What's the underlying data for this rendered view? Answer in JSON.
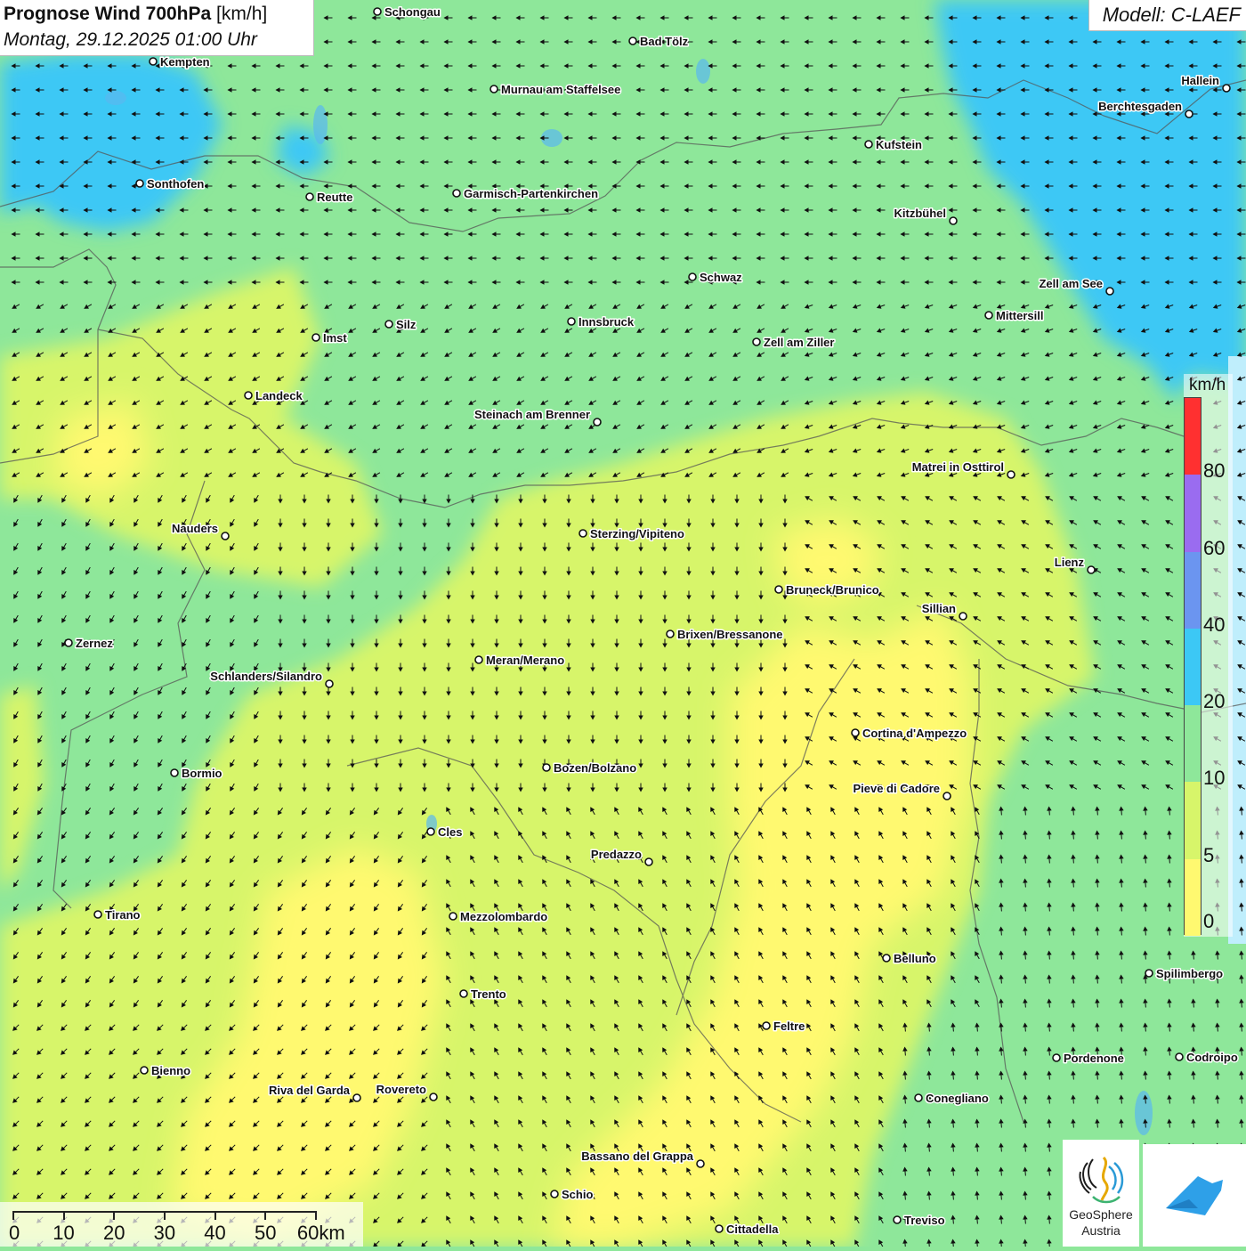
{
  "header": {
    "title_bold": "Prognose Wind 700hPa",
    "title_unit": "[km/h]",
    "date": "Montag, 29.12.2025 01:00 Uhr",
    "model": "Modell: C-LAEF"
  },
  "legend": {
    "unit": "km/h",
    "labels": [
      "80",
      "60",
      "40",
      "20",
      "10",
      "5",
      "0"
    ],
    "colors": [
      "#ff3030",
      "#9a6cf0",
      "#6b95f0",
      "#3cc8f5",
      "#8ee79a",
      "#d7f56a",
      "#fff970"
    ]
  },
  "scale_bar": {
    "labels": [
      "0",
      "10",
      "20",
      "30",
      "40",
      "50",
      "60km"
    ]
  },
  "logo": {
    "name_line1": "GeoSphere",
    "name_line2": "Austria"
  },
  "icons": [
    "geosphere-logo-icon",
    "app-bird-icon"
  ],
  "cities": [
    {
      "name": "Schongau"
    },
    {
      "name": "Bad Tölz"
    },
    {
      "name": "Kempten"
    },
    {
      "name": "Murnau am Staffelsee"
    },
    {
      "name": "Hallein"
    },
    {
      "name": "Berchtesgaden"
    },
    {
      "name": "Kufstein"
    },
    {
      "name": "Sonthofen"
    },
    {
      "name": "Reutte"
    },
    {
      "name": "Garmisch-Partenkirchen"
    },
    {
      "name": "Kitzbühel"
    },
    {
      "name": "Schwaz"
    },
    {
      "name": "Zell am See"
    },
    {
      "name": "Mittersill"
    },
    {
      "name": "Innsbruck"
    },
    {
      "name": "Silz"
    },
    {
      "name": "Imst"
    },
    {
      "name": "Zell am Ziller"
    },
    {
      "name": "Landeck"
    },
    {
      "name": "Steinach am Brenner"
    },
    {
      "name": "Matrei in Osttirol"
    },
    {
      "name": "Nauders"
    },
    {
      "name": "Sterzing/Vipiteno"
    },
    {
      "name": "Lienz"
    },
    {
      "name": "Bruneck/Brunico"
    },
    {
      "name": "Sillian"
    },
    {
      "name": "Brixen/Bressanone"
    },
    {
      "name": "Zernez"
    },
    {
      "name": "Meran/Merano"
    },
    {
      "name": "Schlanders/Silandro"
    },
    {
      "name": "Cortina d'Ampezzo"
    },
    {
      "name": "Bozen/Bolzano"
    },
    {
      "name": "Bormio"
    },
    {
      "name": "Pieve di Cadore"
    },
    {
      "name": "Cles"
    },
    {
      "name": "Predazzo"
    },
    {
      "name": "Tirano"
    },
    {
      "name": "Mezzolombardo"
    },
    {
      "name": "Belluno"
    },
    {
      "name": "Spilimbergo"
    },
    {
      "name": "Trento"
    },
    {
      "name": "Feltre"
    },
    {
      "name": "Bienno"
    },
    {
      "name": "Pordenone"
    },
    {
      "name": "Codroipo"
    },
    {
      "name": "Riva del Garda"
    },
    {
      "name": "Rovereto"
    },
    {
      "name": "Conegliano"
    },
    {
      "name": "Bassano del Grappa"
    },
    {
      "name": "Schio"
    },
    {
      "name": "Treviso"
    },
    {
      "name": "Cittadella"
    }
  ]
}
